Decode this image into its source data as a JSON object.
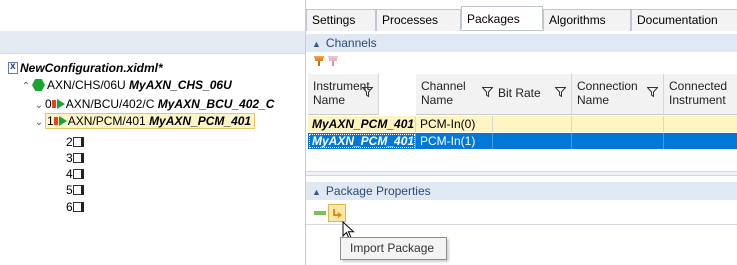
{
  "tree": {
    "root": {
      "label": "NewConfiguration.xidml*"
    },
    "chassis": {
      "path": "AXN/CHS/06U",
      "name": "MyAXN_CHS_06U"
    },
    "slots": [
      {
        "index": "0",
        "path": "AXN/BCU/402/C",
        "name": "MyAXN_BCU_402_C"
      },
      {
        "index": "1",
        "path": "AXN/PCM/401",
        "name": "MyAXN_PCM_401"
      },
      {
        "index": "2"
      },
      {
        "index": "3"
      },
      {
        "index": "4"
      },
      {
        "index": "5"
      },
      {
        "index": "6"
      }
    ]
  },
  "tabs": [
    "Settings",
    "Processes",
    "Packages",
    "Algorithms",
    "Documentation"
  ],
  "active_tab": "Packages",
  "channels": {
    "title": "Channels",
    "columns": [
      {
        "line1": "Instrument",
        "line2": "Name"
      },
      {
        "line1": "Channel",
        "line2": "Name"
      },
      {
        "line1": "Bit Rate",
        "line2": ""
      },
      {
        "line1": "Connection",
        "line2": "Name"
      },
      {
        "line1": "Connected",
        "line2": "Instrument"
      }
    ],
    "rows": [
      {
        "instrument": "MyAXN_PCM_401",
        "channel": "PCM-In(0)",
        "bitrate": "",
        "connection": "",
        "connected": ""
      },
      {
        "instrument": "MyAXN_PCM_401",
        "channel": "PCM-In(1)",
        "bitrate": "",
        "connection": "",
        "connected": ""
      }
    ]
  },
  "package_properties": {
    "title": "Package Properties"
  },
  "tooltip": {
    "text": "Import Package ..."
  },
  "colors": {
    "selected_row": "#0078d7",
    "highlight_row": "#fdf5c2",
    "section_header": "#dfe8f3",
    "chassis_icon": "#1aa32f"
  }
}
